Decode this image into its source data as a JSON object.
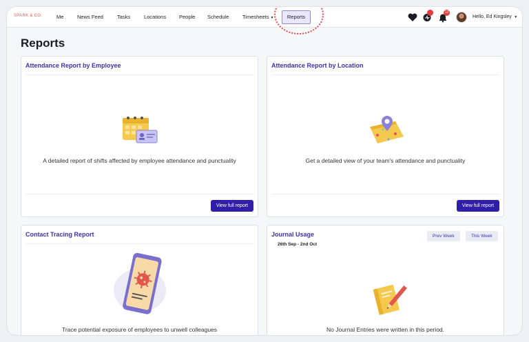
{
  "nav": {
    "brand": "SPARK & CO.",
    "items": [
      "Me",
      "News Feed",
      "Tasks",
      "Locations",
      "People",
      "Schedule",
      "Timesheets"
    ],
    "active": "Reports",
    "notification_count": "13",
    "user_greeting": "Hello, Ed Kingsley"
  },
  "page": {
    "title": "Reports"
  },
  "cards": {
    "employee": {
      "title": "Attendance Report by Employee",
      "description": "A detailed report of shifts affected by employee attendance and punctuality",
      "button": "View full report"
    },
    "location": {
      "title": "Attendance Report by Location",
      "description": "Get a detailed view of your team's attendance and punctuality",
      "button": "View full report"
    },
    "tracing": {
      "title": "Contact Tracing Report",
      "description": "Trace potential exposure of employees to unwell colleagues"
    },
    "journal": {
      "title": "Journal Usage",
      "date_range": "26th Sep - 2nd Oct",
      "prev_week": "Prev Week",
      "this_week": "This Week",
      "empty_message": "No Journal Entries were written in this period."
    }
  },
  "colors": {
    "accent": "#2f1fa8",
    "title": "#3d31b5",
    "brand": "#e2574c",
    "badge": "#e43b3b"
  },
  "icons": [
    "heart-icon",
    "activity-icon",
    "bell-icon",
    "chevron-down-icon"
  ]
}
